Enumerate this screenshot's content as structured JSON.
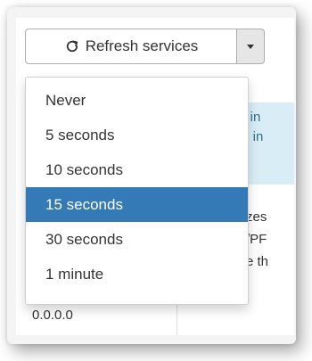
{
  "toolbar": {
    "refresh_label": "Refresh services",
    "refresh_icon": "refresh-icon",
    "caret_icon": "chevron-down-icon"
  },
  "dropdown": {
    "items": [
      {
        "label": "Never"
      },
      {
        "label": "5 seconds"
      },
      {
        "label": "10 seconds"
      },
      {
        "label": "15 seconds",
        "selected": true
      },
      {
        "label": "30 seconds"
      },
      {
        "label": "1 minute"
      }
    ]
  },
  "background_text": {
    "info_line_1": "s in",
    "info_line_2": "d, in",
    "body_line_1": "zes",
    "body_line_2": "/PF",
    "body_line_3": "e th",
    "ip_partial": "0.0.0.0"
  },
  "colors": {
    "selected_bg": "#337ab7",
    "info_bg": "#d9edf7"
  }
}
